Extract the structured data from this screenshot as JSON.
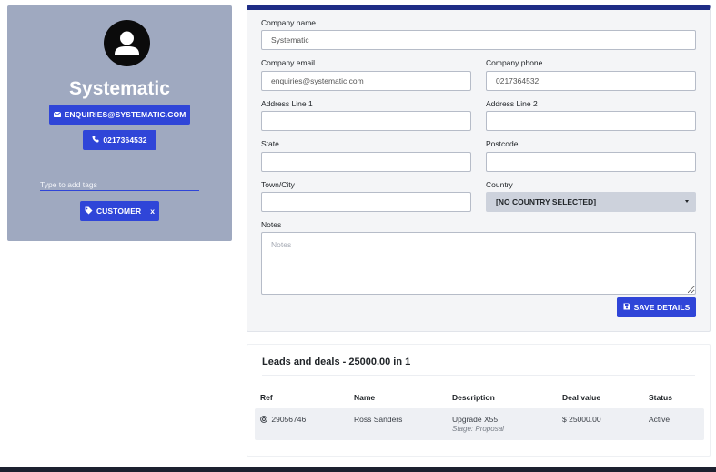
{
  "profile": {
    "company_name": "Systematic",
    "email_button": "ENQUIRIES@SYSTEMATIC.COM",
    "phone_button": "0217364532",
    "tags_placeholder": "Type to add tags",
    "tags": [
      {
        "label": "CUSTOMER",
        "remove": "x"
      }
    ],
    "icons": {
      "avatar": "user-avatar-icon",
      "email": "envelope-icon",
      "phone": "phone-icon",
      "tag": "tag-icon"
    }
  },
  "form": {
    "company_name": {
      "label": "Company name",
      "value": "Systematic"
    },
    "company_email": {
      "label": "Company email",
      "value": "enquiries@systematic.com"
    },
    "company_phone": {
      "label": "Company phone",
      "value": "0217364532"
    },
    "address_line_1": {
      "label": "Address Line 1",
      "value": ""
    },
    "address_line_2": {
      "label": "Address Line 2",
      "value": ""
    },
    "state": {
      "label": "State",
      "value": ""
    },
    "postcode": {
      "label": "Postcode",
      "value": ""
    },
    "town_city": {
      "label": "Town/City",
      "value": ""
    },
    "country": {
      "label": "Country",
      "selected": "[NO COUNTRY SELECTED]"
    },
    "notes": {
      "label": "Notes",
      "placeholder": "Notes"
    },
    "save_button": "SAVE DETAILS"
  },
  "leads": {
    "title": "Leads and deals - 25000.00 in 1",
    "columns": [
      "Ref",
      "Name",
      "Description",
      "Deal value",
      "Status"
    ],
    "rows": [
      {
        "ref": "29056746",
        "name": "Ross Sanders",
        "description": "Upgrade X55",
        "stage": "Stage: Proposal",
        "deal_value": "$ 25000.00",
        "status": "Active"
      }
    ]
  },
  "colors": {
    "accent": "#2f45d8",
    "card_bg": "#9fa9c0",
    "header_bar": "#1f2d86"
  }
}
